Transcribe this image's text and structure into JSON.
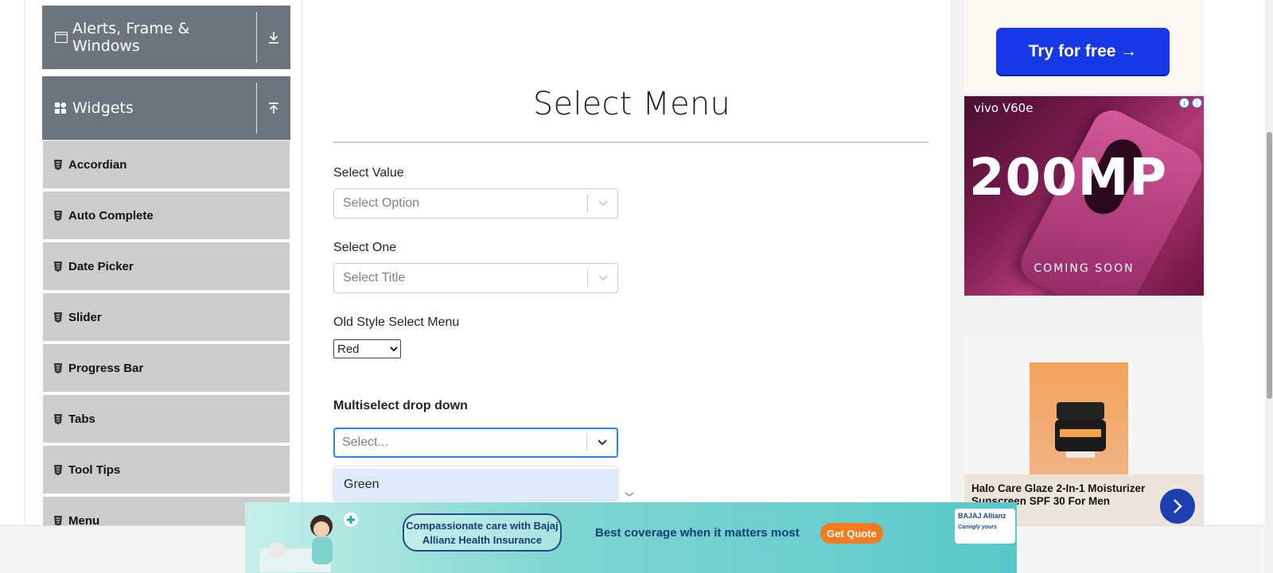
{
  "sidebar": {
    "groups": [
      {
        "label": "Alerts, Frame & Windows",
        "expanded": false
      },
      {
        "label": "Widgets",
        "expanded": true
      }
    ],
    "items": [
      {
        "label": "Accordian"
      },
      {
        "label": "Auto Complete"
      },
      {
        "label": "Date Picker"
      },
      {
        "label": "Slider"
      },
      {
        "label": "Progress Bar"
      },
      {
        "label": "Tabs"
      },
      {
        "label": "Tool Tips"
      },
      {
        "label": "Menu"
      }
    ]
  },
  "main": {
    "title": "Select Menu",
    "select_value": {
      "label": "Select Value",
      "placeholder": "Select Option"
    },
    "select_one": {
      "label": "Select One",
      "placeholder": "Select Title"
    },
    "old_style": {
      "label": "Old Style Select Menu",
      "selected": "Red"
    },
    "multiselect": {
      "label": "Multiselect drop down",
      "placeholder": "Select...",
      "options": [
        "Green"
      ]
    }
  },
  "ads": {
    "top_button": "Try for free →",
    "vivo": {
      "brand": "vivo V60e",
      "headline": "200MP",
      "footer": "COMING SOON"
    },
    "halo": {
      "caption": "Halo Care Glaze 2-In-1 Moisturizer Sunscreen SPF 30 For Men"
    },
    "banner": {
      "pill": "Compassionate care with Bajaj Allianz Health Insurance",
      "tagline": "Best coverage when it matters most",
      "cta": "Get Quote",
      "brand": "BAJAJ Allianz",
      "brand_tag": "Caringly yours"
    }
  },
  "colors": {
    "sidebar_header": "#6c757d",
    "sidebar_item": "#cccccc",
    "focus_border": "#2684ff",
    "option_highlight": "#deebff",
    "cta_blue": "#1638e6",
    "quote_orange": "#f47c20"
  }
}
